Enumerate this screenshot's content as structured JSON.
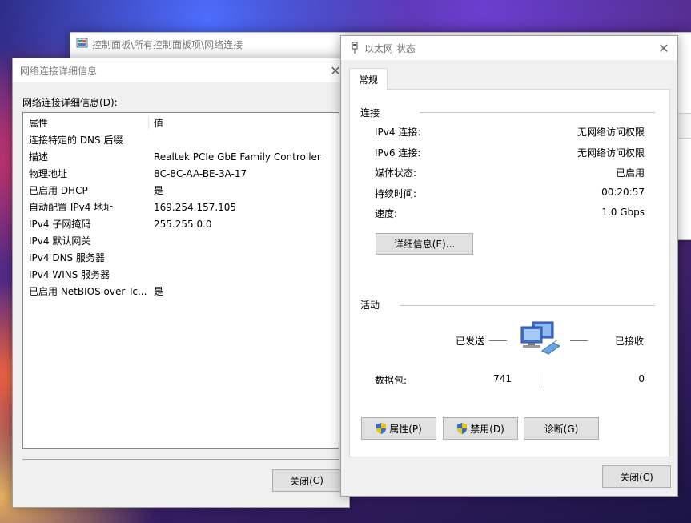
{
  "explorer": {
    "path": "控制面板\\所有控制面板项\\网络连接"
  },
  "detail": {
    "title": "网络连接详细信息",
    "list_label": "网络连接详细信息(",
    "list_label_key": "D",
    "list_label_end": "):",
    "col_property": "属性",
    "col_value": "值",
    "rows": [
      {
        "prop": "连接特定的 DNS 后缀",
        "val": ""
      },
      {
        "prop": "描述",
        "val": "Realtek PCIe GbE Family Controller"
      },
      {
        "prop": "物理地址",
        "val": "8C-8C-AA-BE-3A-17"
      },
      {
        "prop": "已启用 DHCP",
        "val": "是"
      },
      {
        "prop": "自动配置 IPv4 地址",
        "val": "169.254.157.105"
      },
      {
        "prop": "IPv4 子网掩码",
        "val": "255.255.0.0"
      },
      {
        "prop": "IPv4 默认网关",
        "val": ""
      },
      {
        "prop": "IPv4 DNS 服务器",
        "val": ""
      },
      {
        "prop": "IPv4 WINS 服务器",
        "val": ""
      },
      {
        "prop": "已启用 NetBIOS over Tc...",
        "val": "是"
      }
    ],
    "close_label": "关闭(",
    "close_key": "C",
    "close_end": ")"
  },
  "status": {
    "title": "以太网 状态",
    "tab": "常规",
    "section_connection": "连接",
    "fields": [
      {
        "label": "IPv4 连接:",
        "value": "无网络访问权限"
      },
      {
        "label": "IPv6 连接:",
        "value": "无网络访问权限"
      },
      {
        "label": "媒体状态:",
        "value": "已启用"
      },
      {
        "label": "持续时间:",
        "value": "00:20:57"
      },
      {
        "label": "速度:",
        "value": "1.0 Gbps"
      }
    ],
    "details_button": "详细信息(E)...",
    "section_activity": "活动",
    "sent_label": "已发送",
    "received_label": "已接收",
    "packets_label": "数据包:",
    "packets_sent": "741",
    "packets_received": "0",
    "properties_button": "属性(P)",
    "disable_button": "禁用(D)",
    "diagnose_button": "诊断(G)",
    "close_button": "关闭(C)"
  },
  "colors": {
    "shield_blue": "#2d6fd6",
    "shield_yellow": "#f5c400",
    "accent": "#0078d7"
  }
}
